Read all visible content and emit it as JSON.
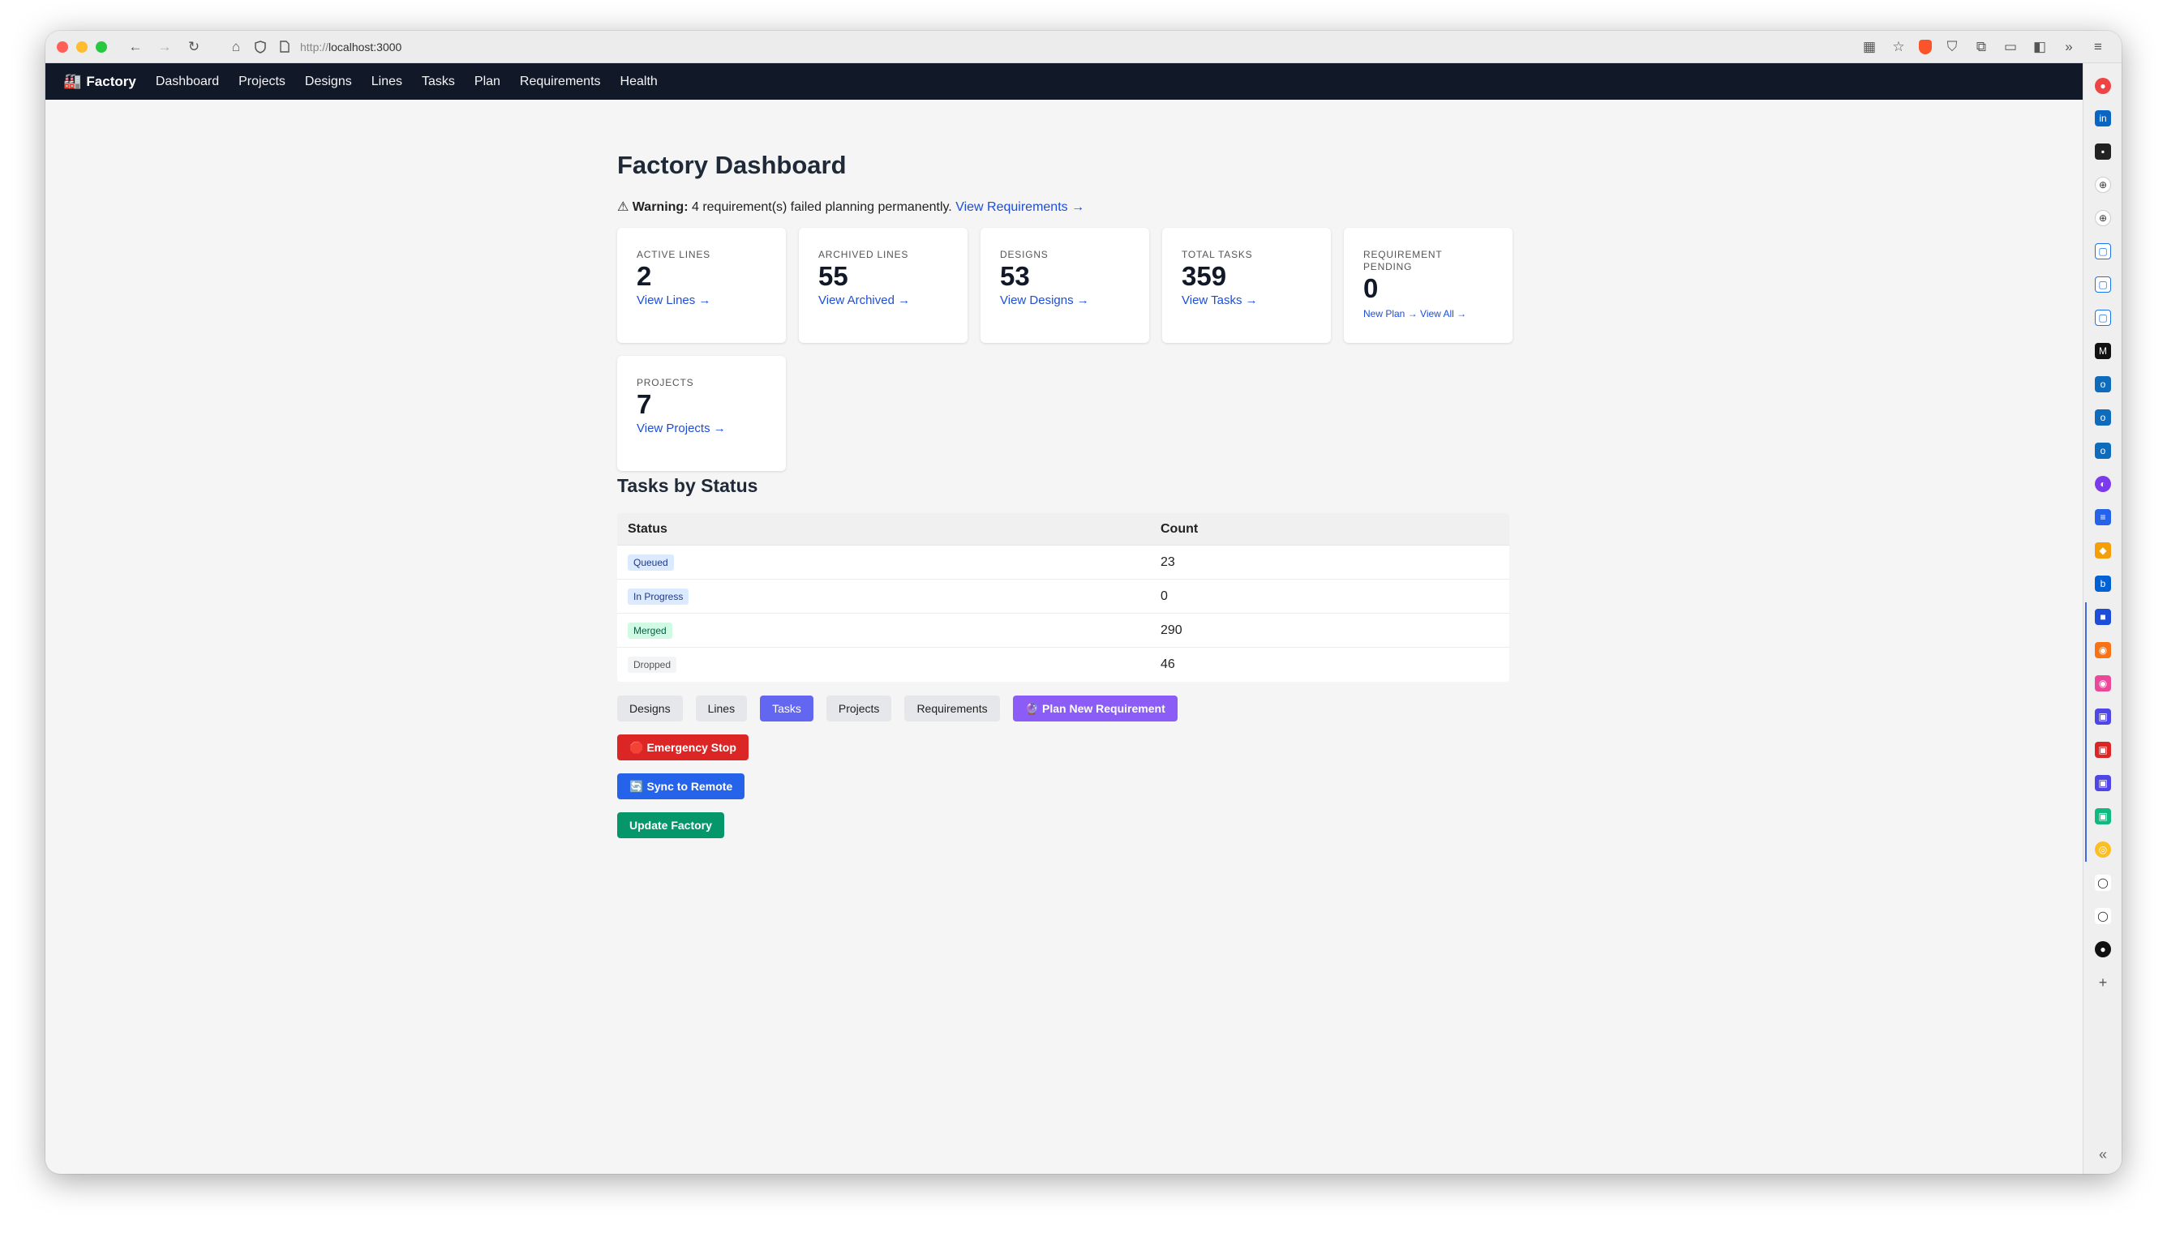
{
  "browser": {
    "url_protocol": "http://",
    "url_host": "localhost:3000"
  },
  "nav": {
    "brand_icon": "🏭",
    "brand": "Factory",
    "links": [
      "Dashboard",
      "Projects",
      "Designs",
      "Lines",
      "Tasks",
      "Plan",
      "Requirements",
      "Health"
    ]
  },
  "page": {
    "title": "Factory Dashboard",
    "warning_icon": "⚠",
    "warning_label": "Warning:",
    "warning_text": "4 requirement(s) failed planning permanently.",
    "warning_link": "View Requirements →"
  },
  "cards": [
    {
      "label": "ACTIVE LINES",
      "value": "2",
      "link": "View Lines →"
    },
    {
      "label": "ARCHIVED LINES",
      "value": "55",
      "link": "View Archived →"
    },
    {
      "label": "DESIGNS",
      "value": "53",
      "link": "View Designs →"
    },
    {
      "label": "TOTAL TASKS",
      "value": "359",
      "link": "View Tasks →"
    },
    {
      "label": "REQUIREMENT PENDING",
      "value": "0",
      "link": "New Plan →",
      "link2": "View All →"
    },
    {
      "label": "PROJECTS",
      "value": "7",
      "link": "View Projects →"
    }
  ],
  "tasks_by_status": {
    "title": "Tasks by Status",
    "headers": [
      "Status",
      "Count"
    ],
    "rows": [
      {
        "status": "Queued",
        "count": "23",
        "bg": "#dbeafe",
        "fg": "#1e3a8a"
      },
      {
        "status": "In Progress",
        "count": "0",
        "bg": "#dbeafe",
        "fg": "#1e3a8a"
      },
      {
        "status": "Merged",
        "count": "290",
        "bg": "#d1fae5",
        "fg": "#065f46"
      },
      {
        "status": "Dropped",
        "count": "46",
        "bg": "#f3f4f6",
        "fg": "#555555"
      }
    ]
  },
  "actions": {
    "designs": "Designs",
    "lines": "Lines",
    "tasks": "Tasks",
    "projects": "Projects",
    "requirements": "Requirements",
    "plan_icon": "🔮",
    "plan_new": "Plan New Requirement",
    "stop_icon": "🛑",
    "emergency_stop": "Emergency Stop",
    "sync_icon": "🔄",
    "sync": "Sync to Remote",
    "update": "Update Factory"
  },
  "colors": {
    "navbar": "#111827",
    "link": "#1d4ed8",
    "active_tab": "#6366f1",
    "purple": "#8b5cf6",
    "red": "#dc2626",
    "blue": "#2563eb",
    "green": "#059669"
  }
}
